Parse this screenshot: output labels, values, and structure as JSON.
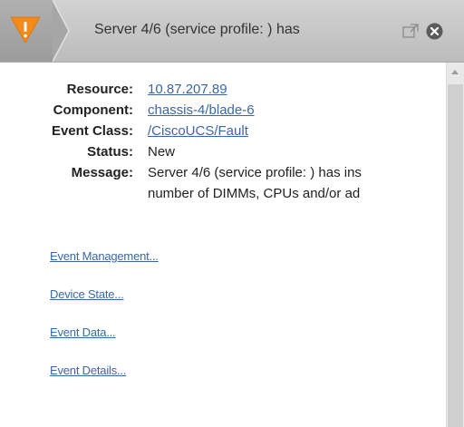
{
  "header": {
    "title": "Server 4/6 (service profile: ) has",
    "severity_icon": "warning-triangle-icon",
    "severity_color": "#f28a1c",
    "popout_icon": "popout-window-icon",
    "close_icon": "close-circle-icon"
  },
  "details": [
    {
      "label": "Resource:",
      "value": "10.87.207.89",
      "is_link": true
    },
    {
      "label": "Component:",
      "value": "chassis-4/blade-6",
      "is_link": true
    },
    {
      "label": "Event Class:",
      "value": "/CiscoUCS/Fault",
      "is_link": true
    },
    {
      "label": "Status:",
      "value": "New",
      "is_link": false
    }
  ],
  "message": {
    "label": "Message:",
    "lines": [
      "Server 4/6 (service profile: ) has ins",
      "number of DIMMs, CPUs and/or ad"
    ]
  },
  "links": [
    "Event Management...",
    "Device State...",
    "Event Data...",
    "Event Details..."
  ],
  "colors": {
    "link": "#3a68a6",
    "header_bg": "#c8c8c8"
  }
}
